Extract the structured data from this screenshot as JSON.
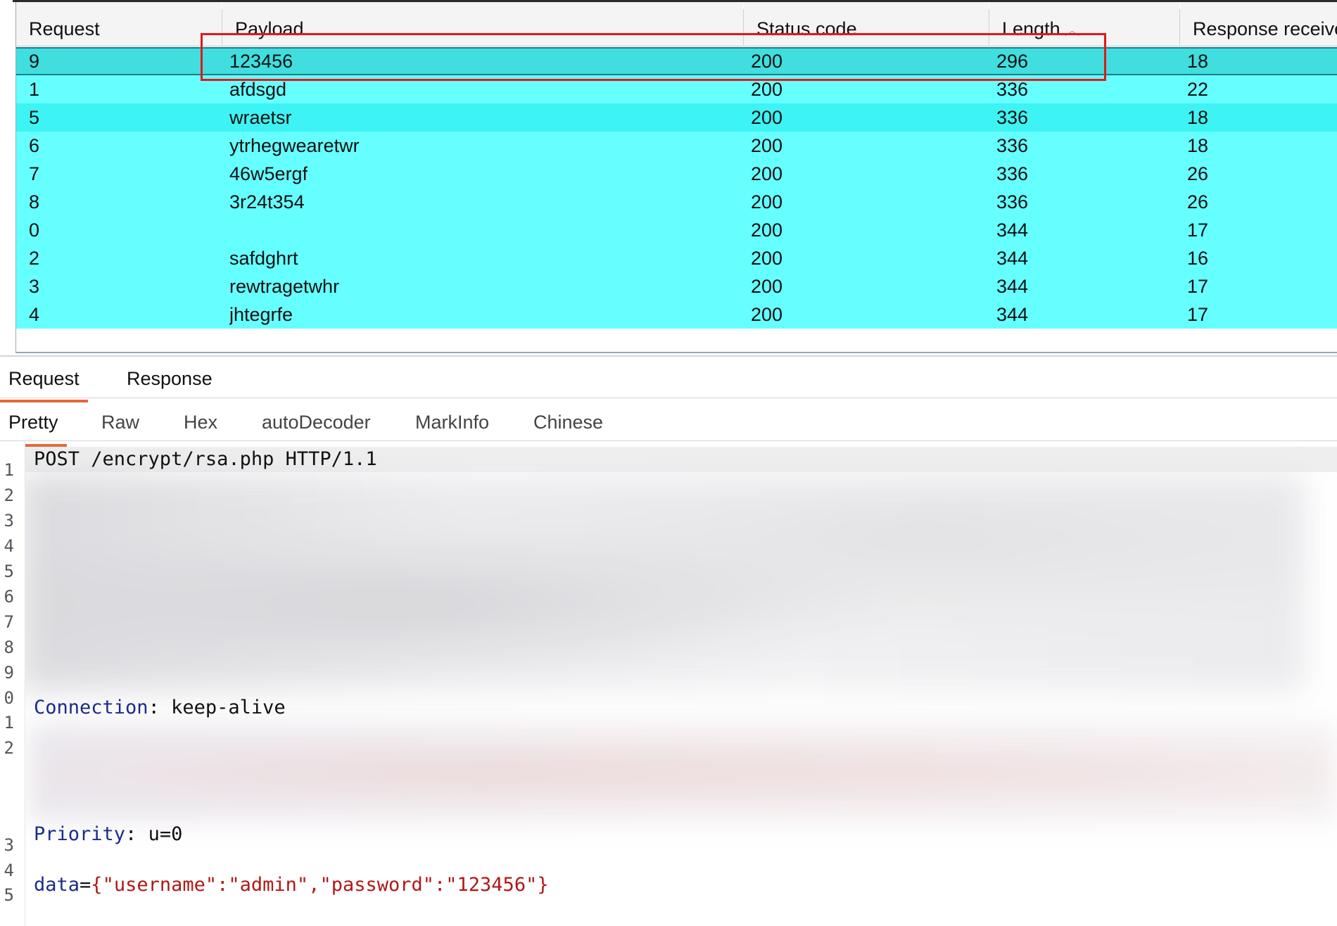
{
  "results": {
    "columns": [
      "Request",
      "Payload",
      "Status code",
      "Length",
      "Response received"
    ],
    "sorted_column": "Length",
    "sort_indicator": "︿",
    "rows": [
      {
        "request": "9",
        "payload": "123456",
        "status": "200",
        "length": "296",
        "received": "18",
        "selected": true
      },
      {
        "request": "1",
        "payload": "afdsgd",
        "status": "200",
        "length": "336",
        "received": "22"
      },
      {
        "request": "5",
        "payload": "wraetsr",
        "status": "200",
        "length": "336",
        "received": "18"
      },
      {
        "request": "6",
        "payload": "ytrhegwearetwr",
        "status": "200",
        "length": "336",
        "received": "18"
      },
      {
        "request": "7",
        "payload": "46w5ergf",
        "status": "200",
        "length": "336",
        "received": "26"
      },
      {
        "request": "8",
        "payload": "3r24t354",
        "status": "200",
        "length": "336",
        "received": "26"
      },
      {
        "request": "0",
        "payload": "",
        "status": "200",
        "length": "344",
        "received": "17"
      },
      {
        "request": "2",
        "payload": "safdghrt",
        "status": "200",
        "length": "344",
        "received": "16"
      },
      {
        "request": "3",
        "payload": "rewtragetwhr",
        "status": "200",
        "length": "344",
        "received": "17"
      },
      {
        "request": "4",
        "payload": "jhtegrfe",
        "status": "200",
        "length": "344",
        "received": "17"
      }
    ]
  },
  "tabs": {
    "request": "Request",
    "response": "Response",
    "active": "Request"
  },
  "subtabs": {
    "items": [
      "Pretty",
      "Raw",
      "Hex",
      "autoDecoder",
      "MarkInfo",
      "Chinese"
    ],
    "active": "Pretty"
  },
  "editor": {
    "line_numbers": [
      "1",
      "2",
      "3",
      "4",
      "5",
      "6",
      "7",
      "8",
      "9",
      "0",
      "1",
      "2",
      "3",
      "4",
      "5"
    ],
    "request_line": "POST /encrypt/rsa.php HTTP/1.1",
    "connection": {
      "name": "Connection",
      "value": "keep-alive"
    },
    "priority": {
      "name": "Priority",
      "value": "u=0"
    },
    "body": {
      "param": "data",
      "equals": "=",
      "open": "{",
      "k1": "\"username\"",
      "colon": ":",
      "v1": "\"admin\"",
      "comma": ",",
      "k2": "\"password\"",
      "v2": "\"123456\"",
      "close": "}"
    }
  },
  "colors": {
    "row_cyan": "#66ffff",
    "row_cyan_alt": "#3ef3f3",
    "row_selected": "#40dede",
    "highlight_box": "#e31818",
    "tab_accent": "#e8663a"
  }
}
